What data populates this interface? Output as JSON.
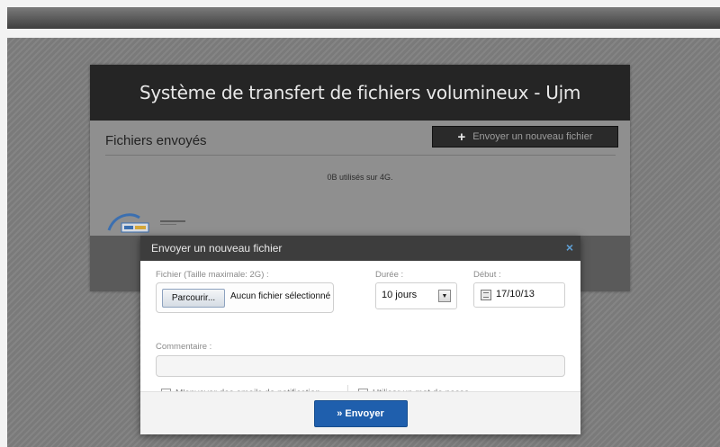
{
  "app": {
    "title": "Système de transfert de fichiers volumineux - Ujm",
    "files_title": "Fichiers envoyés",
    "upload_button": "Envoyer un nouveau fichier",
    "usage_text": "0B utilisés sur 4G."
  },
  "modal": {
    "title": "Envoyer un nouveau fichier",
    "file_label": "Fichier (Taille maximale: 2G) :",
    "browse_button": "Parcourir...",
    "file_status": "Aucun fichier sélectionné",
    "duration_label": "Durée :",
    "duration_value": "10 jours",
    "start_label": "Début :",
    "start_value": "17/10/13",
    "comment_label": "Commentaire :",
    "notify_label": "M'envoyer des emails de notification",
    "notify_checked": true,
    "password_label": "Utiliser un mot de passe",
    "password_checked": false,
    "send_button": "» Envoyer"
  },
  "colors": {
    "header": "#252525",
    "overlay": "#7e7e7e",
    "accent": "#1f5fad"
  }
}
